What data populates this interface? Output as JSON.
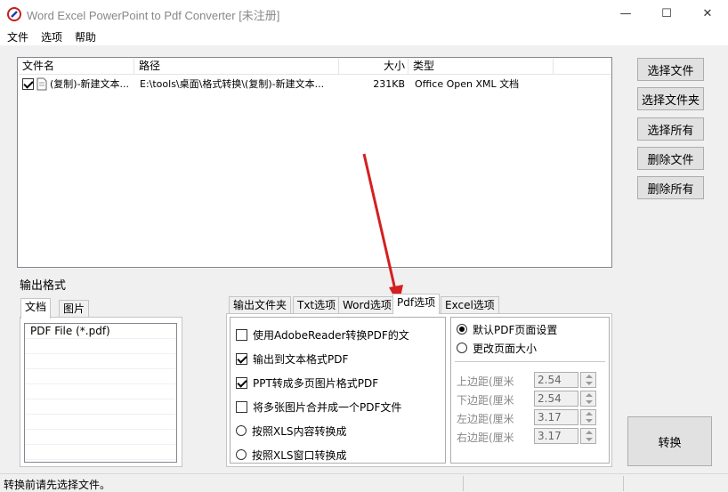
{
  "window": {
    "title": "Word Excel PowerPoint to Pdf Converter [未注册]",
    "minimize": "—",
    "maximize": "☐",
    "close": "✕"
  },
  "menu": [
    "文件",
    "选项",
    "帮助"
  ],
  "file_list": {
    "columns": [
      "文件名",
      "路径",
      "大小",
      "类型"
    ],
    "rows": [
      {
        "checked": true,
        "name": "(复制)-新建文本...",
        "path": "E:\\tools\\桌面\\格式转换\\(复制)-新建文本...",
        "size": "231KB",
        "type": "Office Open XML 文档"
      }
    ]
  },
  "side_buttons": [
    "选择文件",
    "选择文件夹",
    "选择所有",
    "删除文件",
    "删除所有"
  ],
  "output_format": {
    "label": "输出格式",
    "tabs": [
      "文档",
      "图片"
    ],
    "formats": [
      "PDF File  (*.pdf)"
    ]
  },
  "option_tabs": [
    "输出文件夹",
    "Txt选项",
    "Word选项",
    "Pdf选项",
    "Excel选项"
  ],
  "pdf_options": {
    "checks": [
      {
        "label": "使用AdobeReader转换PDF的文",
        "checked": false
      },
      {
        "label": "输出到文本格式PDF",
        "checked": true
      },
      {
        "label": "PPT转成多页图片格式PDF",
        "checked": true
      },
      {
        "label": "将多张图片合并成一个PDF文件",
        "checked": false
      }
    ],
    "radios": [
      {
        "label": "按照XLS内容转换成",
        "checked": false
      },
      {
        "label": "按照XLS窗口转换成",
        "checked": false
      }
    ]
  },
  "page_settings": {
    "radios": [
      {
        "label": "默认PDF页面设置",
        "checked": true
      },
      {
        "label": "更改页面大小",
        "checked": false
      }
    ],
    "margins": [
      {
        "label": "上边距(厘米",
        "value": "2.54"
      },
      {
        "label": "下边距(厘米",
        "value": "2.54"
      },
      {
        "label": "左边距(厘米",
        "value": "3.17"
      },
      {
        "label": "右边距(厘米",
        "value": "3.17"
      }
    ]
  },
  "convert_button": "转换",
  "status": "转换前请先选择文件。",
  "colors": {
    "arrow": "#d42020"
  }
}
